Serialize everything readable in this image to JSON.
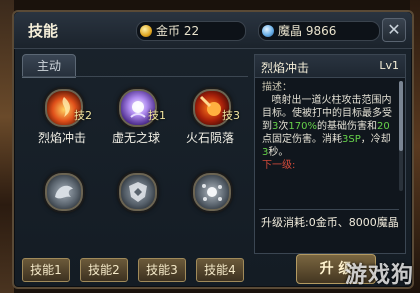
{
  "window": {
    "title": "技能",
    "close_icon": "close-icon"
  },
  "currency": {
    "gold_label": "金币",
    "gold_value": "22",
    "gem_label": "魔晶",
    "gem_value": "9866"
  },
  "tabs": [
    {
      "label": "主动"
    }
  ],
  "skills": [
    {
      "name": "烈焰冲击",
      "level": "技2",
      "icon": "fire-impact-icon"
    },
    {
      "name": "虚无之球",
      "level": "技1",
      "icon": "void-orb-icon"
    },
    {
      "name": "火石陨落",
      "level": "技3",
      "icon": "meteor-icon"
    },
    {
      "name": "",
      "level": "",
      "icon": "dragon-icon"
    },
    {
      "name": "",
      "level": "",
      "icon": "shield-rune-icon"
    },
    {
      "name": "",
      "level": "",
      "icon": "scatter-orb-icon"
    }
  ],
  "detail": {
    "name": "烈焰冲击",
    "level": "Lv1",
    "desc_label": "描述：",
    "desc_1": "喷射出一道火柱攻击范围内目标。使被打中的目标最多受到",
    "desc_hits": "3",
    "desc_2": "次",
    "desc_pct": "170%",
    "desc_3": "的基础伤害和",
    "desc_fixed": "20",
    "desc_4": "点固定伤害。消耗",
    "desc_sp": "3SP",
    "desc_5": "，冷却",
    "desc_cd": "3",
    "desc_6": "秒。",
    "next_label": "下一级:",
    "cost_label": "升级消耗:",
    "cost_value": "0金币、8000魔晶"
  },
  "bottom_buttons": [
    "技能1",
    "技能2",
    "技能3",
    "技能4"
  ],
  "upgrade_label": "升 级",
  "watermark": "游戏狗",
  "colors": {
    "highlight_green": "#66d24a",
    "next_red": "#d24a3a",
    "frame_gold": "#5a4a36"
  }
}
